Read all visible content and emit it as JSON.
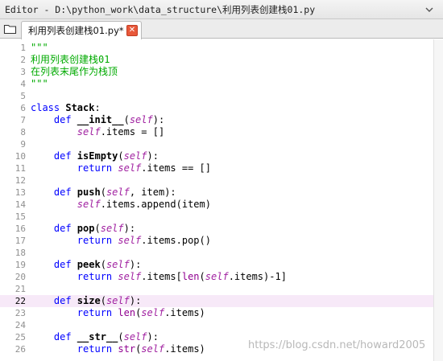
{
  "window": {
    "title": "Editor - D:\\python_work\\data_structure\\利用列表创建栈01.py"
  },
  "tabs": [
    {
      "label": "利用列表创建栈01.py*",
      "modified": true
    }
  ],
  "editor": {
    "active_line": 22,
    "lines": [
      {
        "n": "1",
        "tokens": [
          {
            "t": "\"\"\"",
            "c": "str"
          }
        ]
      },
      {
        "n": "2",
        "tokens": [
          {
            "t": "利用列表创建栈01",
            "c": "str"
          }
        ]
      },
      {
        "n": "3",
        "tokens": [
          {
            "t": "在列表末尾作为栈顶",
            "c": "str"
          }
        ]
      },
      {
        "n": "4",
        "tokens": [
          {
            "t": "\"\"\"",
            "c": "str"
          }
        ]
      },
      {
        "n": "5",
        "tokens": []
      },
      {
        "n": "6",
        "tokens": [
          {
            "t": "class ",
            "c": "kw"
          },
          {
            "t": "Stack",
            "c": "cls"
          },
          {
            "t": ":",
            "c": "plain"
          }
        ]
      },
      {
        "n": "7",
        "tokens": [
          {
            "t": "    def ",
            "c": "kw"
          },
          {
            "t": "__init__",
            "c": "def"
          },
          {
            "t": "(",
            "c": "plain"
          },
          {
            "t": "self",
            "c": "self"
          },
          {
            "t": "):",
            "c": "plain"
          }
        ]
      },
      {
        "n": "8",
        "tokens": [
          {
            "t": "        ",
            "c": "plain"
          },
          {
            "t": "self",
            "c": "self"
          },
          {
            "t": ".items = []",
            "c": "plain"
          }
        ]
      },
      {
        "n": "9",
        "tokens": []
      },
      {
        "n": "10",
        "tokens": [
          {
            "t": "    def ",
            "c": "kw"
          },
          {
            "t": "isEmpty",
            "c": "def"
          },
          {
            "t": "(",
            "c": "plain"
          },
          {
            "t": "self",
            "c": "self"
          },
          {
            "t": "):",
            "c": "plain"
          }
        ]
      },
      {
        "n": "11",
        "tokens": [
          {
            "t": "        return ",
            "c": "kw"
          },
          {
            "t": "self",
            "c": "self"
          },
          {
            "t": ".items == []",
            "c": "plain"
          }
        ]
      },
      {
        "n": "12",
        "tokens": []
      },
      {
        "n": "13",
        "tokens": [
          {
            "t": "    def ",
            "c": "kw"
          },
          {
            "t": "push",
            "c": "def"
          },
          {
            "t": "(",
            "c": "plain"
          },
          {
            "t": "self",
            "c": "self"
          },
          {
            "t": ", item):",
            "c": "plain"
          }
        ]
      },
      {
        "n": "14",
        "tokens": [
          {
            "t": "        ",
            "c": "plain"
          },
          {
            "t": "self",
            "c": "self"
          },
          {
            "t": ".items.append(item)",
            "c": "plain"
          }
        ]
      },
      {
        "n": "15",
        "tokens": []
      },
      {
        "n": "16",
        "tokens": [
          {
            "t": "    def ",
            "c": "kw"
          },
          {
            "t": "pop",
            "c": "def"
          },
          {
            "t": "(",
            "c": "plain"
          },
          {
            "t": "self",
            "c": "self"
          },
          {
            "t": "):",
            "c": "plain"
          }
        ]
      },
      {
        "n": "17",
        "tokens": [
          {
            "t": "        return ",
            "c": "kw"
          },
          {
            "t": "self",
            "c": "self"
          },
          {
            "t": ".items.pop()",
            "c": "plain"
          }
        ]
      },
      {
        "n": "18",
        "tokens": []
      },
      {
        "n": "19",
        "tokens": [
          {
            "t": "    def ",
            "c": "kw"
          },
          {
            "t": "peek",
            "c": "def"
          },
          {
            "t": "(",
            "c": "plain"
          },
          {
            "t": "self",
            "c": "self"
          },
          {
            "t": "):",
            "c": "plain"
          }
        ]
      },
      {
        "n": "20",
        "tokens": [
          {
            "t": "        return ",
            "c": "kw"
          },
          {
            "t": "self",
            "c": "self"
          },
          {
            "t": ".items[",
            "c": "plain"
          },
          {
            "t": "len",
            "c": "builtin"
          },
          {
            "t": "(",
            "c": "plain"
          },
          {
            "t": "self",
            "c": "self"
          },
          {
            "t": ".items)-1]",
            "c": "plain"
          }
        ]
      },
      {
        "n": "21",
        "tokens": []
      },
      {
        "n": "22",
        "tokens": [
          {
            "t": "    def ",
            "c": "kw"
          },
          {
            "t": "size",
            "c": "def"
          },
          {
            "t": "(",
            "c": "plain"
          },
          {
            "t": "self",
            "c": "self"
          },
          {
            "t": "):",
            "c": "plain"
          }
        ]
      },
      {
        "n": "23",
        "tokens": [
          {
            "t": "        return ",
            "c": "kw"
          },
          {
            "t": "len",
            "c": "builtin"
          },
          {
            "t": "(",
            "c": "plain"
          },
          {
            "t": "self",
            "c": "self"
          },
          {
            "t": ".items)",
            "c": "plain"
          }
        ]
      },
      {
        "n": "24",
        "tokens": []
      },
      {
        "n": "25",
        "tokens": [
          {
            "t": "    def ",
            "c": "kw"
          },
          {
            "t": "__str__",
            "c": "def"
          },
          {
            "t": "(",
            "c": "plain"
          },
          {
            "t": "self",
            "c": "self"
          },
          {
            "t": "):",
            "c": "plain"
          }
        ]
      },
      {
        "n": "26",
        "tokens": [
          {
            "t": "        return ",
            "c": "kw"
          },
          {
            "t": "str",
            "c": "builtin"
          },
          {
            "t": "(",
            "c": "plain"
          },
          {
            "t": "self",
            "c": "self"
          },
          {
            "t": ".items)",
            "c": "plain"
          }
        ]
      }
    ]
  },
  "watermark": "https://blog.csdn.net/howard2005",
  "icons": {
    "browse": "folder-icon",
    "tab_close": "close-icon",
    "title_menu": "options-icon"
  },
  "colors": {
    "keyword": "#0000ff",
    "string": "#00aa00",
    "self": "#a020a0",
    "builtin": "#900090",
    "active_line": "#f7e9f8",
    "close_button": "#e8583a"
  }
}
